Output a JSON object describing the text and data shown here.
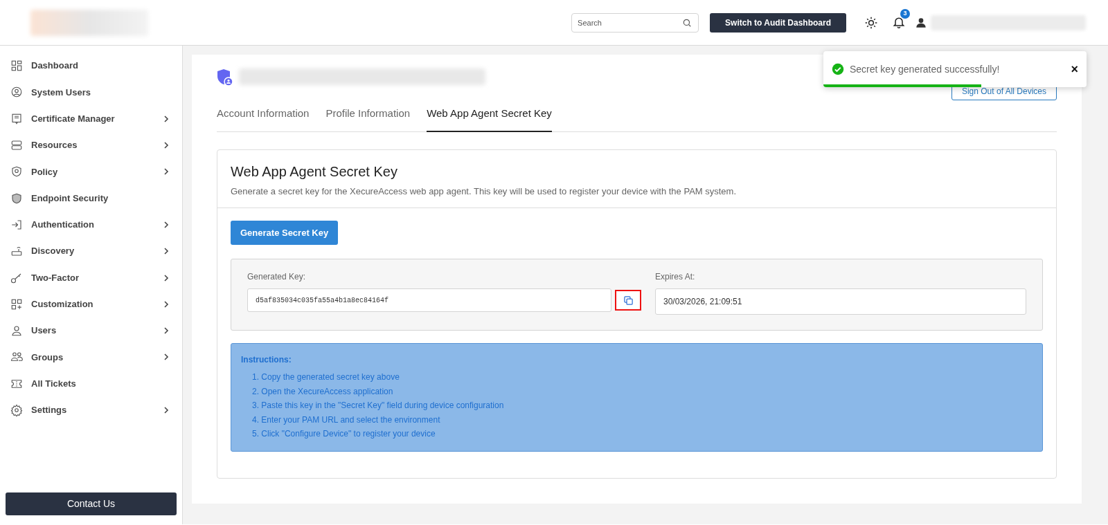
{
  "header": {
    "search": {
      "placeholder": "Search"
    },
    "switch_button": "Switch to Audit Dashboard",
    "notification_count": "3"
  },
  "sidebar": {
    "items": [
      {
        "label": "Dashboard",
        "expandable": false
      },
      {
        "label": "System Users",
        "expandable": false
      },
      {
        "label": "Certificate Manager",
        "expandable": true
      },
      {
        "label": "Resources",
        "expandable": true
      },
      {
        "label": "Policy",
        "expandable": true
      },
      {
        "label": "Endpoint Security",
        "expandable": false
      },
      {
        "label": "Authentication",
        "expandable": true
      },
      {
        "label": "Discovery",
        "expandable": true
      },
      {
        "label": "Two-Factor",
        "expandable": true
      },
      {
        "label": "Customization",
        "expandable": true
      },
      {
        "label": "Users",
        "expandable": true
      },
      {
        "label": "Groups",
        "expandable": true
      },
      {
        "label": "All Tickets",
        "expandable": false
      },
      {
        "label": "Settings",
        "expandable": true
      }
    ],
    "contact_button": "Contact Us"
  },
  "profile": {
    "sign_out_button": "Sign Out of All Devices",
    "tabs": [
      {
        "label": "Account Information",
        "selected": false
      },
      {
        "label": "Profile Information",
        "selected": false
      },
      {
        "label": "Web App Agent Secret Key",
        "selected": true
      }
    ]
  },
  "card": {
    "title": "Web App Agent Secret Key",
    "description": "Generate a secret key for the XecureAccess web app agent. This key will be used to register your device with the PAM system.",
    "generate_button": "Generate Secret Key",
    "generated_key": {
      "label": "Generated Key:",
      "value": "d5af835034c035fa55a4b1a8ec84164f"
    },
    "expires_at": {
      "label": "Expires At:",
      "value": "30/03/2026, 21:09:51"
    },
    "instructions": {
      "title": "Instructions:",
      "steps": [
        "1. Copy the generated secret key above",
        "2. Open the XecureAccess application",
        "3. Paste this key in the \"Secret Key\" field during device configuration",
        "4. Enter your PAM URL and select the environment",
        "5. Click \"Configure Device\" to register your device"
      ]
    }
  },
  "toast": {
    "message": "Secret key generated successfully!",
    "close": "×",
    "level": 0.6
  }
}
